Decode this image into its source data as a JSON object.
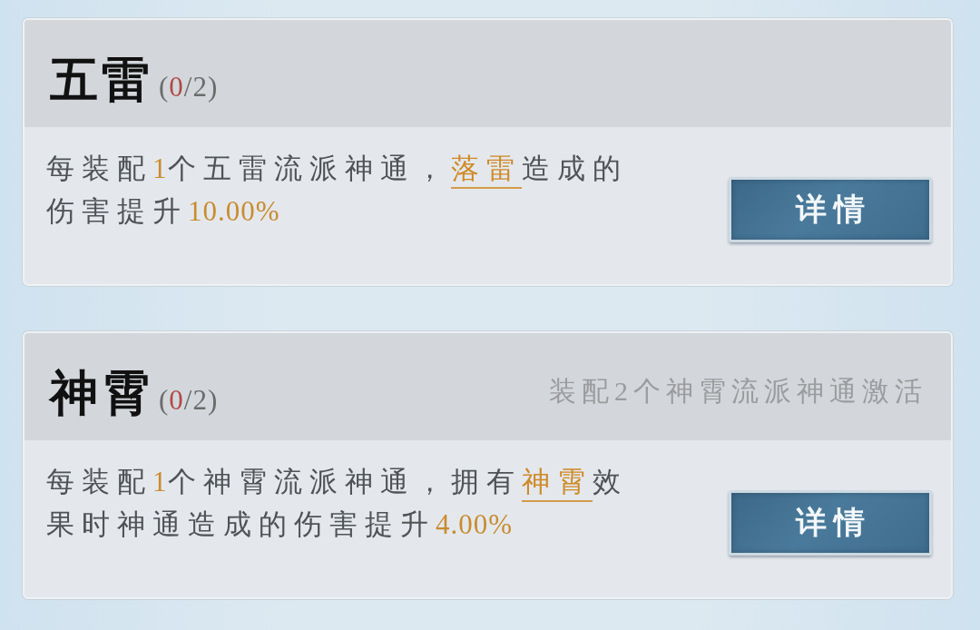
{
  "sets": [
    {
      "title": "五雷",
      "count": [
        {
          "text": "(",
          "kind": "plain"
        },
        {
          "text": "0",
          "kind": "current"
        },
        {
          "text": "/2)",
          "kind": "plain"
        }
      ],
      "description": [
        [
          {
            "text": "每装配",
            "kind": "plain"
          },
          {
            "text": "1",
            "kind": "value"
          },
          {
            "text": "个五雷流派神通，",
            "kind": "plain"
          },
          {
            "text": "落雷",
            "kind": "keyword"
          },
          {
            "text": "造成的",
            "kind": "plain"
          }
        ],
        [
          {
            "text": "伤害提升",
            "kind": "plain"
          },
          {
            "text": "10.00%",
            "kind": "value"
          }
        ]
      ],
      "button": "详情"
    },
    {
      "title": "神霄",
      "count": [
        {
          "text": "(",
          "kind": "plain"
        },
        {
          "text": "0",
          "kind": "current"
        },
        {
          "text": "/2)",
          "kind": "plain"
        }
      ],
      "hint": "装配2个神霄流派神通激活",
      "description": [
        [
          {
            "text": "每装配",
            "kind": "plain"
          },
          {
            "text": "1",
            "kind": "value"
          },
          {
            "text": "个神霄流派神通，拥有",
            "kind": "plain"
          },
          {
            "text": "神霄",
            "kind": "keyword"
          },
          {
            "text": "效",
            "kind": "plain"
          }
        ],
        [
          {
            "text": "果时神通造成的伤害提升",
            "kind": "plain"
          },
          {
            "text": "4.00%",
            "kind": "value"
          }
        ]
      ],
      "button": "详情"
    }
  ]
}
